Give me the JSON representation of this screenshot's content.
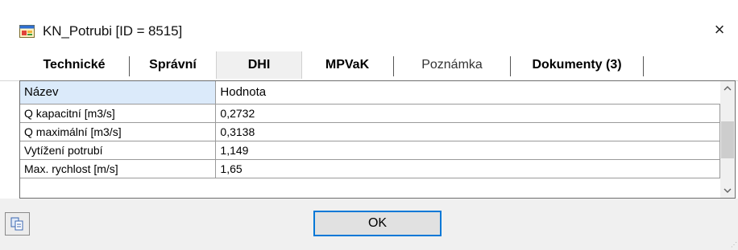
{
  "window": {
    "title": "KN_Potrubi [ID = 8515]",
    "close_label": "×"
  },
  "tabs": [
    {
      "label": "Technické"
    },
    {
      "label": "Správní"
    },
    {
      "label": "DHI"
    },
    {
      "label": "MPVaK"
    },
    {
      "label": "Poznámka"
    },
    {
      "label": "Dokumenty (3)"
    }
  ],
  "grid": {
    "headers": {
      "name": "Název",
      "value": "Hodnota"
    },
    "rows": [
      {
        "name": "Q kapacitní [m3/s]",
        "value": "0,2732"
      },
      {
        "name": "Q maximální [m3/s]",
        "value": "0,3138"
      },
      {
        "name": "Vytížení potrubí",
        "value": "1,149"
      },
      {
        "name": "Max. rychlost [m/s]",
        "value": "1,65"
      }
    ],
    "scroll_up": "^",
    "scroll_down": "v"
  },
  "footer": {
    "ok_label": "OK",
    "copy_icon": "copy-icon"
  },
  "colors": {
    "header_highlight": "#dbeafa",
    "ok_border": "#0078d7",
    "footer_bg": "#f0f0f0"
  }
}
